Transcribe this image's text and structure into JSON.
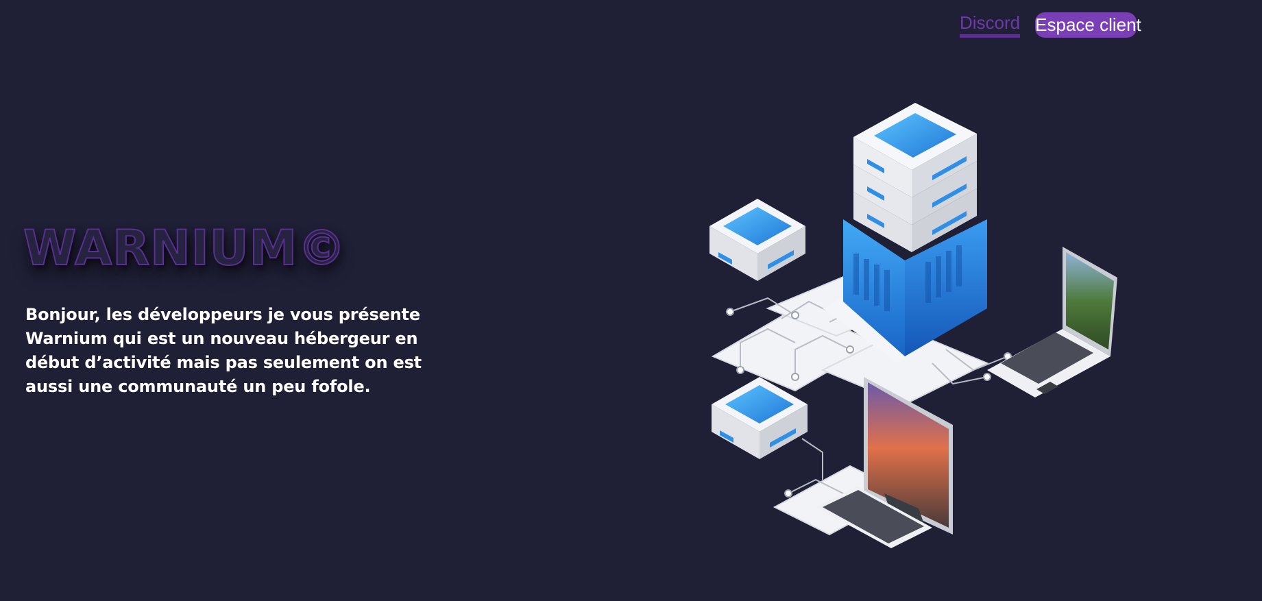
{
  "nav": {
    "discord_label": "Discord",
    "client_area_label": "Espace client"
  },
  "hero": {
    "brand": "WARNIUM©",
    "intro": "Bonjour, les développeurs je vous présente Warnium qui est un nouveau hébergeur en début d’activité mais pas seulement on est aussi une communauté un peu fofole."
  },
  "colors": {
    "background": "#1f1f36",
    "accent": "#7a3fb6",
    "link": "#6d38a8",
    "server_blue": "#2f95e6"
  },
  "icons": {
    "illustration": "isometric-server-network-illustration"
  }
}
